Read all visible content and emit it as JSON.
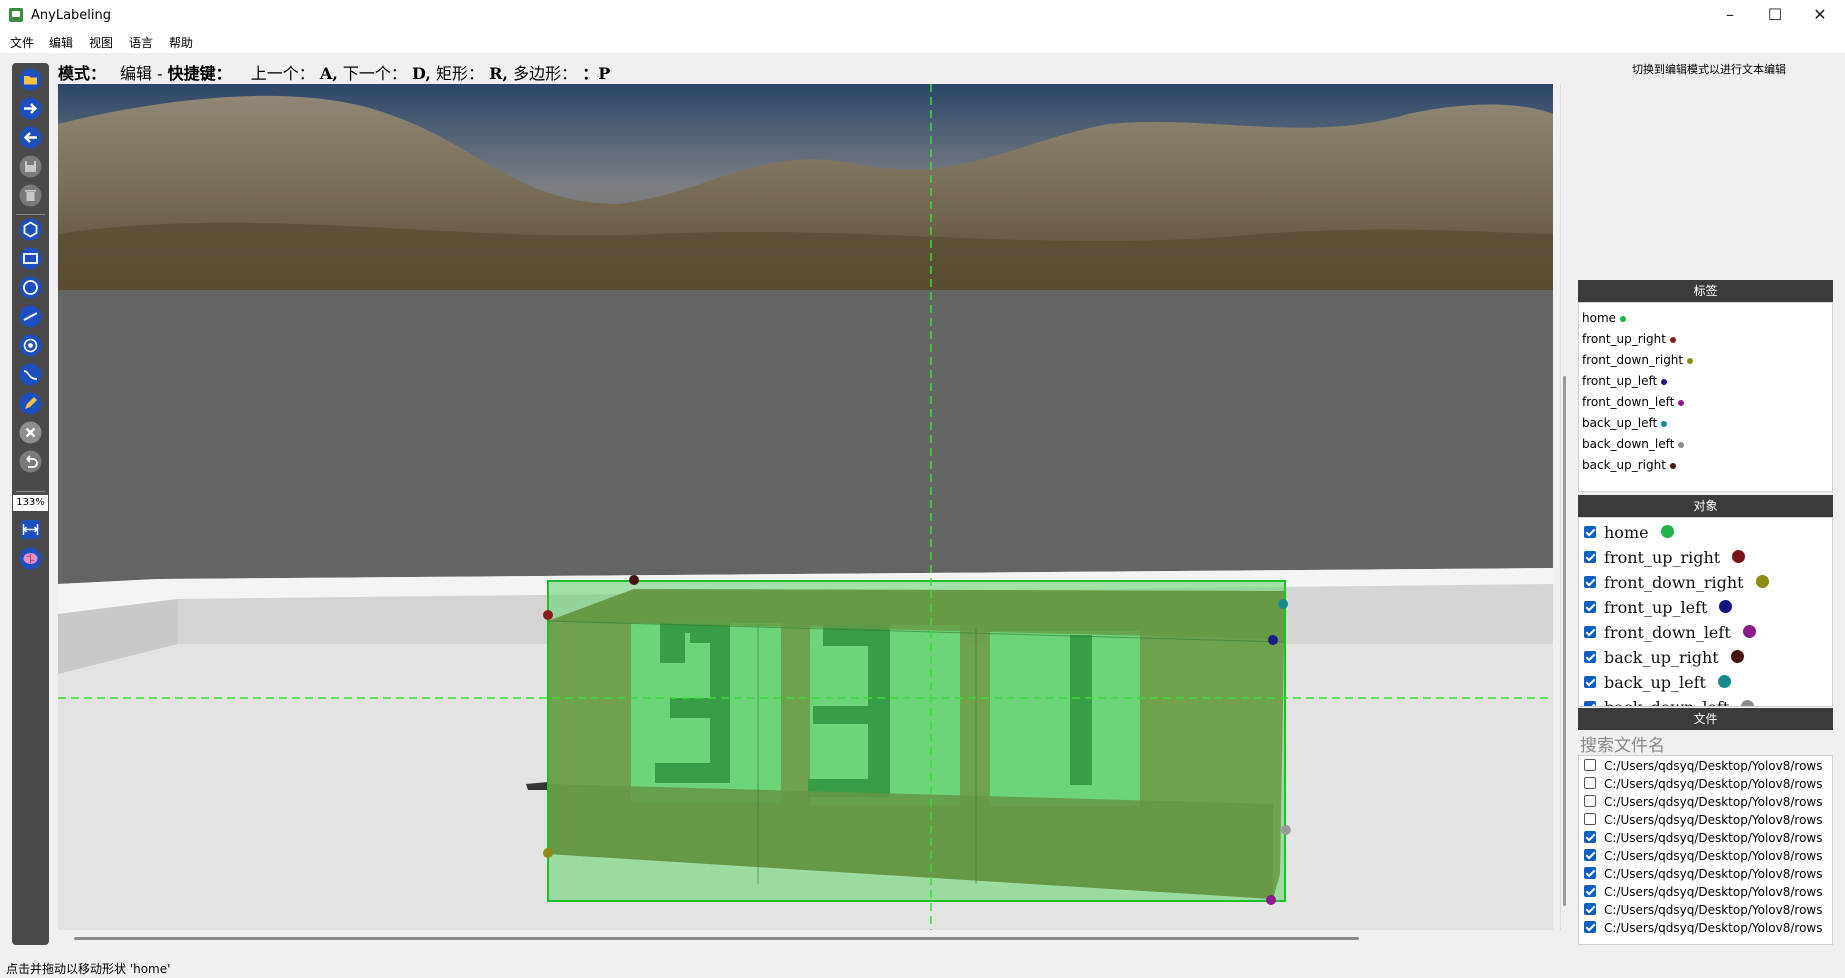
{
  "window": {
    "title": "AnyLabeling",
    "minimize": "–",
    "maximize": "☐",
    "close": "✕"
  },
  "menu": [
    "文件",
    "编辑",
    "视图",
    "语言",
    "帮助"
  ],
  "toolbar": {
    "tools": [
      "open-icon",
      "next-image-icon",
      "prev-image-icon",
      "save-icon",
      "delete-icon",
      "polygon-icon",
      "rectangle-icon",
      "circle-icon",
      "line-icon",
      "point-icon",
      "linestrip-icon",
      "edit-icon",
      "cancel-icon",
      "undo-icon",
      "fit-width-icon",
      "brain-icon"
    ],
    "zoom": "133%"
  },
  "mode_bar": {
    "mode_label": "模式：",
    "mode_value": "编辑",
    "dash": "-",
    "shortcut_label": "快捷键：",
    "prev_label": "上一个：",
    "prev_key": "A,",
    "next_label": "下一个：",
    "next_key": "D,",
    "rect_label": "矩形：",
    "rect_key": "R,",
    "poly_label": "多边形：",
    "poly_key": "：P"
  },
  "right_hint": "切换到编辑模式以进行文本编辑",
  "labels_panel": {
    "title": "标签",
    "items": [
      {
        "name": "home",
        "color": "#22b14c"
      },
      {
        "name": "front_up_right",
        "color": "#8b1a1a"
      },
      {
        "name": "front_down_right",
        "color": "#8b8b16"
      },
      {
        "name": "front_up_left",
        "color": "#1a1a8b"
      },
      {
        "name": "front_down_left",
        "color": "#8b1a8b"
      },
      {
        "name": "back_up_left",
        "color": "#178b8b"
      },
      {
        "name": "back_down_left",
        "color": "#8b8b8b"
      },
      {
        "name": "back_up_right",
        "color": "#4a1010"
      }
    ]
  },
  "objects_panel": {
    "title": "对象",
    "items": [
      {
        "name": "home",
        "color": "#22b14c",
        "checked": true
      },
      {
        "name": "front_up_right",
        "color": "#7a1414",
        "checked": true
      },
      {
        "name": "front_down_right",
        "color": "#8b8b16",
        "checked": true
      },
      {
        "name": "front_up_left",
        "color": "#121280",
        "checked": true
      },
      {
        "name": "front_down_left",
        "color": "#8b1a8b",
        "checked": true
      },
      {
        "name": "back_up_right",
        "color": "#4a1010",
        "checked": true
      },
      {
        "name": "back_up_left",
        "color": "#178b8b",
        "checked": true
      },
      {
        "name": "back_down_left",
        "color": "#8b8b8b",
        "checked": true
      }
    ]
  },
  "files_panel": {
    "title": "文件",
    "search_placeholder": "搜索文件名",
    "items": [
      {
        "path": "C:/Users/qdsyq/Desktop/Yolov8/rows",
        "checked": false
      },
      {
        "path": "C:/Users/qdsyq/Desktop/Yolov8/rows",
        "checked": false
      },
      {
        "path": "C:/Users/qdsyq/Desktop/Yolov8/rows",
        "checked": false
      },
      {
        "path": "C:/Users/qdsyq/Desktop/Yolov8/rows",
        "checked": false
      },
      {
        "path": "C:/Users/qdsyq/Desktop/Yolov8/rows",
        "checked": true
      },
      {
        "path": "C:/Users/qdsyq/Desktop/Yolov8/rows",
        "checked": true
      },
      {
        "path": "C:/Users/qdsyq/Desktop/Yolov8/rows",
        "checked": true
      },
      {
        "path": "C:/Users/qdsyq/Desktop/Yolov8/rows",
        "checked": true
      },
      {
        "path": "C:/Users/qdsyq/Desktop/Yolov8/rows",
        "checked": true
      },
      {
        "path": "C:/Users/qdsyq/Desktop/Yolov8/rows",
        "checked": true
      }
    ]
  },
  "status": "点击并拖动以移动形状 'home'"
}
